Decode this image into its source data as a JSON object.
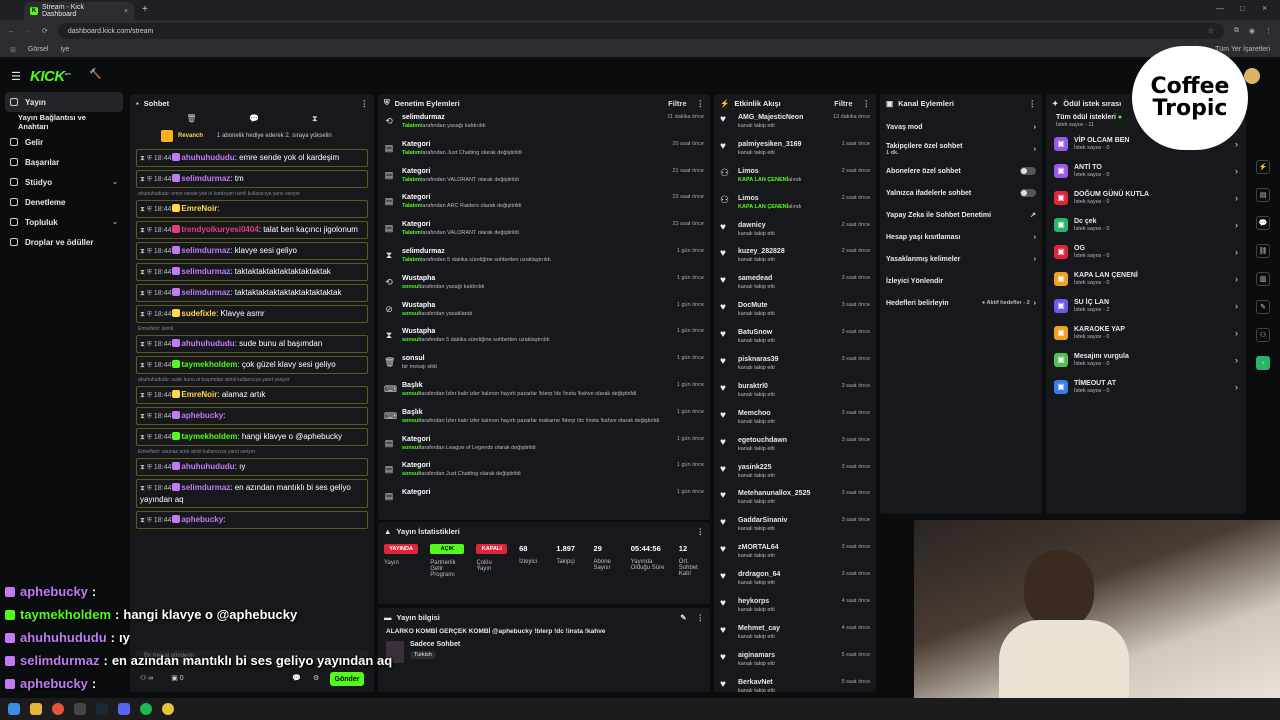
{
  "browser": {
    "tab_title": "Stream - Kick Dashboard",
    "url": "dashboard.kick.com/stream",
    "bookmarks": [
      "Görsel",
      "iye"
    ],
    "all_bookmarks": "Tüm Yer İşaretleri"
  },
  "app": {
    "logo": "KICK",
    "logo_sup": "BETA"
  },
  "sidebar": {
    "items": [
      {
        "label": "Yayın",
        "active": true
      },
      {
        "label": "Yayın Bağlantısı ve Anahtarı"
      },
      {
        "label": "Gelir"
      },
      {
        "label": "Başarılar"
      },
      {
        "label": "Stüdyo",
        "chev": "⌄"
      },
      {
        "label": "Denetleme"
      },
      {
        "label": "Topluluk",
        "chev": "⌄"
      },
      {
        "label": "Droplar ve ödüller"
      }
    ]
  },
  "chat": {
    "title": "Sohbet",
    "pinned_user": "Revanch",
    "pinned_text": "1 abonelik hediye ederek 2. sıraya yükselin",
    "messages": [
      {
        "time": "18:44",
        "user": "ahuhuhududu",
        "color": "#c17cf5",
        "text": "emre sende yok ol kardeşim"
      },
      {
        "time": "18:44",
        "user": "selimdurmaz",
        "color": "#c17cf5",
        "text": "tm"
      },
      {
        "reply": "ahuhuhududu: emre sende yok ol kardeşim isimli kullanıcıya yanıt veriyor",
        "time": "18:44",
        "user": "EmreNoir",
        "color": "#ffd84a",
        "text": ""
      },
      {
        "time": "18:44",
        "user": "trendyolkuryesi0404",
        "color": "#e0407a",
        "text": "talat ben kaçıncı jigolonum"
      },
      {
        "time": "18:44",
        "user": "selimdurmaz",
        "color": "#c17cf5",
        "text": "klavye sesi geliyo"
      },
      {
        "time": "18:44",
        "user": "selimdurmaz",
        "color": "#c17cf5",
        "text": "taktaktaktaktaktaktaktaktak"
      },
      {
        "time": "18:44",
        "user": "selimdurmaz",
        "color": "#c17cf5",
        "text": "taktaktaktaktaktaktaktaktaktak"
      },
      {
        "time": "18:44",
        "user": "sudefixle",
        "color": "#ffd84a",
        "text": "Klavye asmr"
      },
      {
        "reply": "EmreNoir: isimli",
        "time": "18:44",
        "user": "ahuhuhududu",
        "color": "#c17cf5",
        "text": "sude bunu al başımdan"
      },
      {
        "time": "18:44",
        "user": "taymekholdem",
        "color": "#53fc18",
        "text": "çok güzel klavy sesi geliyo"
      },
      {
        "reply": "ahuhuhududu: sude bunu al başımdan isimli kullanıcıya yanıt veriyor",
        "time": "18:44",
        "user": "EmreNoir",
        "color": "#ffd84a",
        "text": "alamaz artık"
      },
      {
        "time": "18:44",
        "user": "aphebucky",
        "color": "#c17cf5",
        "text": ""
      },
      {
        "time": "18:44",
        "user": "taymekholdem",
        "color": "#53fc18",
        "text": "hangi klavye o @aphebucky"
      },
      {
        "reply": "EmreNoir: alamaz artık isimli kullanıcıya yanıt veriyor",
        "time": "18:44",
        "user": "ahuhuhududu",
        "color": "#c17cf5",
        "text": "ıy"
      },
      {
        "time": "18:44",
        "user": "selimdurmaz",
        "color": "#c17cf5",
        "text": "en azından mantıklı bi ses geliyo yayından aq"
      },
      {
        "time": "18:44",
        "user": "aphebucky",
        "color": "#c17cf5",
        "text": ""
      }
    ],
    "input_placeholder": "Bir mesaj gönderin",
    "send": "Gönder",
    "users": "0"
  },
  "mod": {
    "title": "Denetim Eylemleri",
    "filter": "Filtre",
    "events": [
      {
        "icon": "⟲",
        "title": "selimdurmaz",
        "by": "Talatım",
        "text": "tarafından yasağı kaldırıldı",
        "time": "11 dakika önce"
      },
      {
        "icon": "▤",
        "title": "Kategori",
        "by": "Talatım",
        "text": "tarafından Just Chatting olarak değiştirildi",
        "time": "20 saat önce"
      },
      {
        "icon": "▤",
        "title": "Kategori",
        "by": "Talatım",
        "text": "tarafından VALORANT olarak değiştirildi",
        "time": "21 saat önce"
      },
      {
        "icon": "▤",
        "title": "Kategori",
        "by": "Talatım",
        "text": "tarafından ARC Raiders olarak değiştirildi",
        "time": "23 saat önce"
      },
      {
        "icon": "▤",
        "title": "Kategori",
        "by": "Talatım",
        "text": "tarafından VALORANT olarak değiştirildi",
        "time": "23 saat önce"
      },
      {
        "icon": "⧗",
        "title": "selimdurmaz",
        "by": "Talatım",
        "text": "tarafından 5 dakika süreliğine sohbetten uzaklaştırıldı",
        "time": "1 gün önce"
      },
      {
        "icon": "⟲",
        "title": "Wustapha",
        "by": "sonsul",
        "text": "tarafından yasağı kaldırıldı",
        "time": "1 gün önce"
      },
      {
        "icon": "⊘",
        "title": "Wustapha",
        "by": "sonsul",
        "text": "tarafından yasaklandı",
        "time": "1 gün önce"
      },
      {
        "icon": "⧗",
        "title": "Wustapha",
        "by": "sonsul",
        "text": "tarafından 5 dakika süreliğine sohbetten uzaklaştırıldı",
        "time": "1 gün önce"
      },
      {
        "icon": "🗑",
        "title": "sonsul",
        "by": "",
        "text": "bir mesajı sildi",
        "time": "1 gün önce"
      },
      {
        "icon": "⌨",
        "title": "Başlık",
        "by": "sonsul",
        "text": "tarafından İzler kalır izler kalırsın hayırlı pazarlar !blerp !dc !insta !kahve olarak değiştirildi",
        "time": "1 gün önce"
      },
      {
        "icon": "⌨",
        "title": "Başlık",
        "by": "sonsul",
        "text": "tarafından İzler kalır izler kalırsın hayırlı pazarlar makarne !blerp !dc !insta !kahve olarak değiştirildi",
        "time": "1 gün önce"
      },
      {
        "icon": "▤",
        "title": "Kategori",
        "by": "sonsul",
        "text": "tarafından League of Legends olarak değiştirildi",
        "time": "1 gün önce"
      },
      {
        "icon": "▤",
        "title": "Kategori",
        "by": "sonsul",
        "text": "tarafından Just Chatting olarak değiştirildi",
        "time": "1 gün önce"
      },
      {
        "icon": "▤",
        "title": "Kategori",
        "by": "",
        "text": "",
        "time": "1 gün önce"
      }
    ]
  },
  "stats": {
    "title": "Yayın İstatistikleri",
    "badges": [
      {
        "label": "YAYINDA",
        "sub": "Yayın",
        "color": "#e0243a"
      },
      {
        "label": "AÇIK",
        "sub": "Partnerlik Gelir Programı",
        "color": "#53fc18"
      },
      {
        "label": "KAPALI",
        "sub": "Çoklu Yayın",
        "color": "#e0243a"
      }
    ],
    "values": [
      {
        "v": "68",
        "l": "İzleyici"
      },
      {
        "v": "1.897",
        "l": "Takipçi"
      },
      {
        "v": "29",
        "l": "Abone Sayısı"
      },
      {
        "v": "05:44:56",
        "l": "Yayında Olduğu Süre"
      },
      {
        "v": "12",
        "l": "Ort. Sohbet Katıl"
      }
    ]
  },
  "info": {
    "title": "Yayın bilgisi",
    "stream_title": "ALARKO KOMBİ GERÇEK KOMBİ @aphebucky !blerp !dc !insta !kahve",
    "category": "Sadece Sohbet",
    "tag": "Turkish"
  },
  "activity": {
    "title": "Etkinlik Akışı",
    "filter": "Filtre",
    "items": [
      {
        "name": "AMG_MajesticNeon",
        "sub": "kanalı takip etti",
        "time": "13 dakika önce"
      },
      {
        "name": "palmiyesiken_3169",
        "sub": "kanalı takip etti",
        "time": "1 saat önce"
      },
      {
        "name": "Limos",
        "sub": "KAPA LAN ÇENENİ",
        "extra": "alındı",
        "green": true,
        "time": "2 saat önce"
      },
      {
        "name": "Limos",
        "sub": "KAPA LAN ÇENENİ",
        "extra": "alındı",
        "green": true,
        "time": "2 saat önce"
      },
      {
        "name": "dawnicy",
        "sub": "kanalı takip etti",
        "time": "2 saat önce"
      },
      {
        "name": "kuzey_282828",
        "sub": "kanalı takip etti",
        "time": "2 saat önce"
      },
      {
        "name": "samedead",
        "sub": "kanalı takip etti",
        "time": "3 saat önce"
      },
      {
        "name": "DocMute",
        "sub": "kanalı takip etti",
        "time": "3 saat önce"
      },
      {
        "name": "BatuSnow",
        "sub": "kanalı takip etti",
        "time": "3 saat önce"
      },
      {
        "name": "pisknaras39",
        "sub": "kanalı takip etti",
        "time": "3 saat önce"
      },
      {
        "name": "buraktrl0",
        "sub": "kanalı takip etti",
        "time": "3 saat önce"
      },
      {
        "name": "Memchoo",
        "sub": "kanalı takip etti",
        "time": "3 saat önce"
      },
      {
        "name": "egetouchdawn",
        "sub": "kanalı takip etti",
        "time": "3 saat önce"
      },
      {
        "name": "yasink225",
        "sub": "kanalı takip etti",
        "time": "3 saat önce"
      },
      {
        "name": "Metehanunallox_2525",
        "sub": "kanalı takip etti",
        "time": "3 saat önce"
      },
      {
        "name": "GaddarSinaniv",
        "sub": "kanalı takip etti",
        "time": "3 saat önce"
      },
      {
        "name": "zMORTAL64",
        "sub": "kanalı takip etti",
        "time": "3 saat önce"
      },
      {
        "name": "drdragon_64",
        "sub": "kanalı takip etti",
        "time": "3 saat önce"
      },
      {
        "name": "heykorps",
        "sub": "kanalı takip etti",
        "time": "4 saat önce"
      },
      {
        "name": "Mehmet_cay",
        "sub": "kanalı takip etti",
        "time": "4 saat önce"
      },
      {
        "name": "aiginamars",
        "sub": "kanalı takip etti",
        "time": "5 saat önce"
      },
      {
        "name": "BerkavNet",
        "sub": "kanalı takip etti",
        "time": "5 saat önce"
      }
    ]
  },
  "channel": {
    "title": "Kanal Eylemleri",
    "options": [
      {
        "label": "Yavaş mod",
        "r": "›"
      },
      {
        "label": "Takipçilere özel sohbet",
        "sub": "1 dk.",
        "r": "›"
      },
      {
        "label": "Abonelere özel sohbet",
        "toggle": true
      },
      {
        "label": "Yalnızca ifadelerle sohbet",
        "toggle": true
      },
      {
        "label": "Yapay Zeka ile Sohbet Denetimi",
        "r": "↗"
      },
      {
        "label": "Hesap yaşı kısıtlaması",
        "r": "›"
      },
      {
        "label": "Yasaklanmış kelimeler",
        "r": "›"
      },
      {
        "label": "İzleyici Yönlendir",
        "r": ""
      },
      {
        "label": "Hedefleri belirleyin",
        "extra": "● Aktif hedefler - 2",
        "r": "›"
      }
    ]
  },
  "rewards": {
    "title": "Ödül istek sırası",
    "all": "Tüm ödül istekleri",
    "all_count": "İstek sayısı - 11",
    "items": [
      {
        "name": "VİP OLCAM BEN",
        "count": "İstek sayısı - 0",
        "color": "#9b59e6"
      },
      {
        "name": "ANTİ TO",
        "count": "İstek sayısı - 0",
        "color": "#9b59e6"
      },
      {
        "name": "DOĞUM GÜNÜ KUTLA",
        "count": "İstek sayısı - 0",
        "color": "#e0243a"
      },
      {
        "name": "Dc çek",
        "count": "İstek sayısı - 0",
        "color": "#26b56a"
      },
      {
        "name": "OG",
        "count": "İstek sayısı - 0",
        "color": "#e0243a"
      },
      {
        "name": "KAPA LAN ÇENENİ",
        "count": "İstek sayısı - 0",
        "color": "#f0a020"
      },
      {
        "name": "SU İÇ LAN",
        "count": "İstek sayısı - 2",
        "color": "#6a5af0"
      },
      {
        "name": "KARAOKE YAP",
        "count": "İstek sayısı - 0",
        "color": "#f0a020"
      },
      {
        "name": "Mesajını vurgula",
        "count": "İstek sayısı - 0",
        "color": "#53c050"
      },
      {
        "name": "TİMEOUT AT",
        "count": "İstek sayısı - 0",
        "color": "#3a7de6"
      }
    ]
  },
  "overlay": {
    "lines": [
      {
        "user": "aphebucky",
        "color": "#c17cf5",
        "text": ""
      },
      {
        "user": "taymekholdem",
        "color": "#53fc18",
        "text": "hangi klavye o @aphebucky"
      },
      {
        "user": "ahuhuhududu",
        "color": "#c17cf5",
        "text": "ıy"
      },
      {
        "user": "selimdurmaz",
        "color": "#c17cf5",
        "text": "en azından mantıklı bi ses geliyo yayından aq"
      },
      {
        "user": "aphebucky",
        "color": "#c17cf5",
        "text": ""
      }
    ],
    "brand": "Coffee Tropic"
  }
}
